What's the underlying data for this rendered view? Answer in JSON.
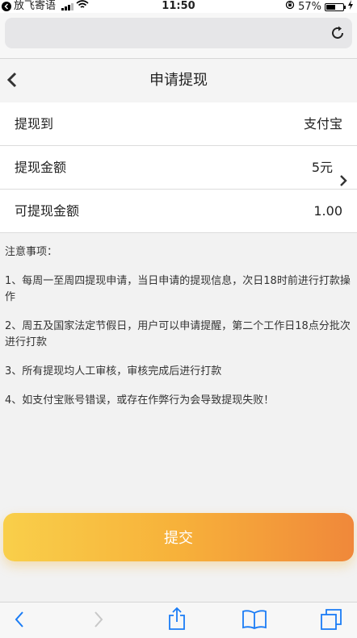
{
  "status_bar": {
    "carrier": "放飞寄语",
    "time": "11:50",
    "battery_percent": "57%",
    "battery_level": 0.57
  },
  "browser": {
    "icons": [
      "back-app-icon",
      "signal-icon",
      "wifi-icon",
      "rotation-lock-icon",
      "battery-icon",
      "charging-icon",
      "reload-icon"
    ]
  },
  "nav": {
    "title": "申请提现",
    "back_icon": "chevron-left-icon"
  },
  "form": {
    "rows": [
      {
        "label": "提现到",
        "value": "支付宝"
      },
      {
        "label": "提现金额",
        "value": "5元",
        "icon": "chevron-right-icon"
      },
      {
        "label": "可提现金额",
        "value": "1.00"
      }
    ]
  },
  "notes": {
    "title": "注意事项：",
    "items": [
      "1、每周一至周四提现申请，当日申请的提现信息，次日18时前进行打款操作",
      "2、周五及国家法定节假日，用户可以申请提醒，第二个工作日18点分批次进行打款",
      "3、所有提现均人工审核，审核完成后进行打款",
      "4、如支付宝账号错误，或存在作弊行为会导致提现失败！"
    ]
  },
  "submit": {
    "label": "提交"
  },
  "toolbar": {
    "icons": [
      "back-icon",
      "forward-icon",
      "share-icon",
      "bookmarks-icon",
      "tabs-icon"
    ]
  },
  "colors": {
    "accent_start": "#f9cf4a",
    "accent_end": "#f0883a",
    "toolbar_blue": "#1a7cf5"
  }
}
